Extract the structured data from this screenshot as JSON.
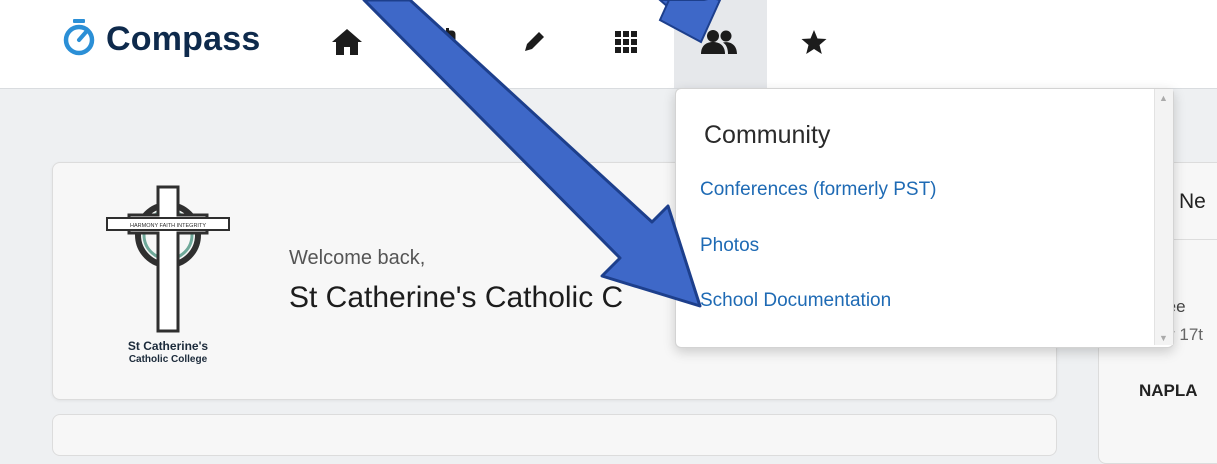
{
  "brand": {
    "name": "Compass",
    "logo_icon": "compass-stopwatch-icon"
  },
  "nav": {
    "items": [
      {
        "icon": "home-icon"
      },
      {
        "icon": "calendar-icon"
      },
      {
        "icon": "pencil-icon"
      },
      {
        "icon": "grid-icon"
      },
      {
        "icon": "people-icon",
        "active": true
      },
      {
        "icon": "star-icon"
      }
    ]
  },
  "dropdown": {
    "title": "Community",
    "items": [
      {
        "label": "Conferences (formerly PST)"
      },
      {
        "label": "Photos"
      },
      {
        "label": "School Documentation"
      }
    ]
  },
  "welcome_card": {
    "greeting": "Welcome back,",
    "school_name": "St Catherine's Catholic C",
    "logo_line1": "St Catherine's",
    "logo_line2": "Catholic College",
    "logo_banner": "HARMONY FAITH INTEGRITY"
  },
  "right_panel": {
    "heading_partial": "Ne",
    "line1_partial": "ree",
    "line2_partial": "r 17t",
    "bold_partial": "NAPLA"
  },
  "colors": {
    "brand_navy": "#0e2a4c",
    "link_blue": "#1e6ab4",
    "arrow_blue": "#3e68c8"
  }
}
